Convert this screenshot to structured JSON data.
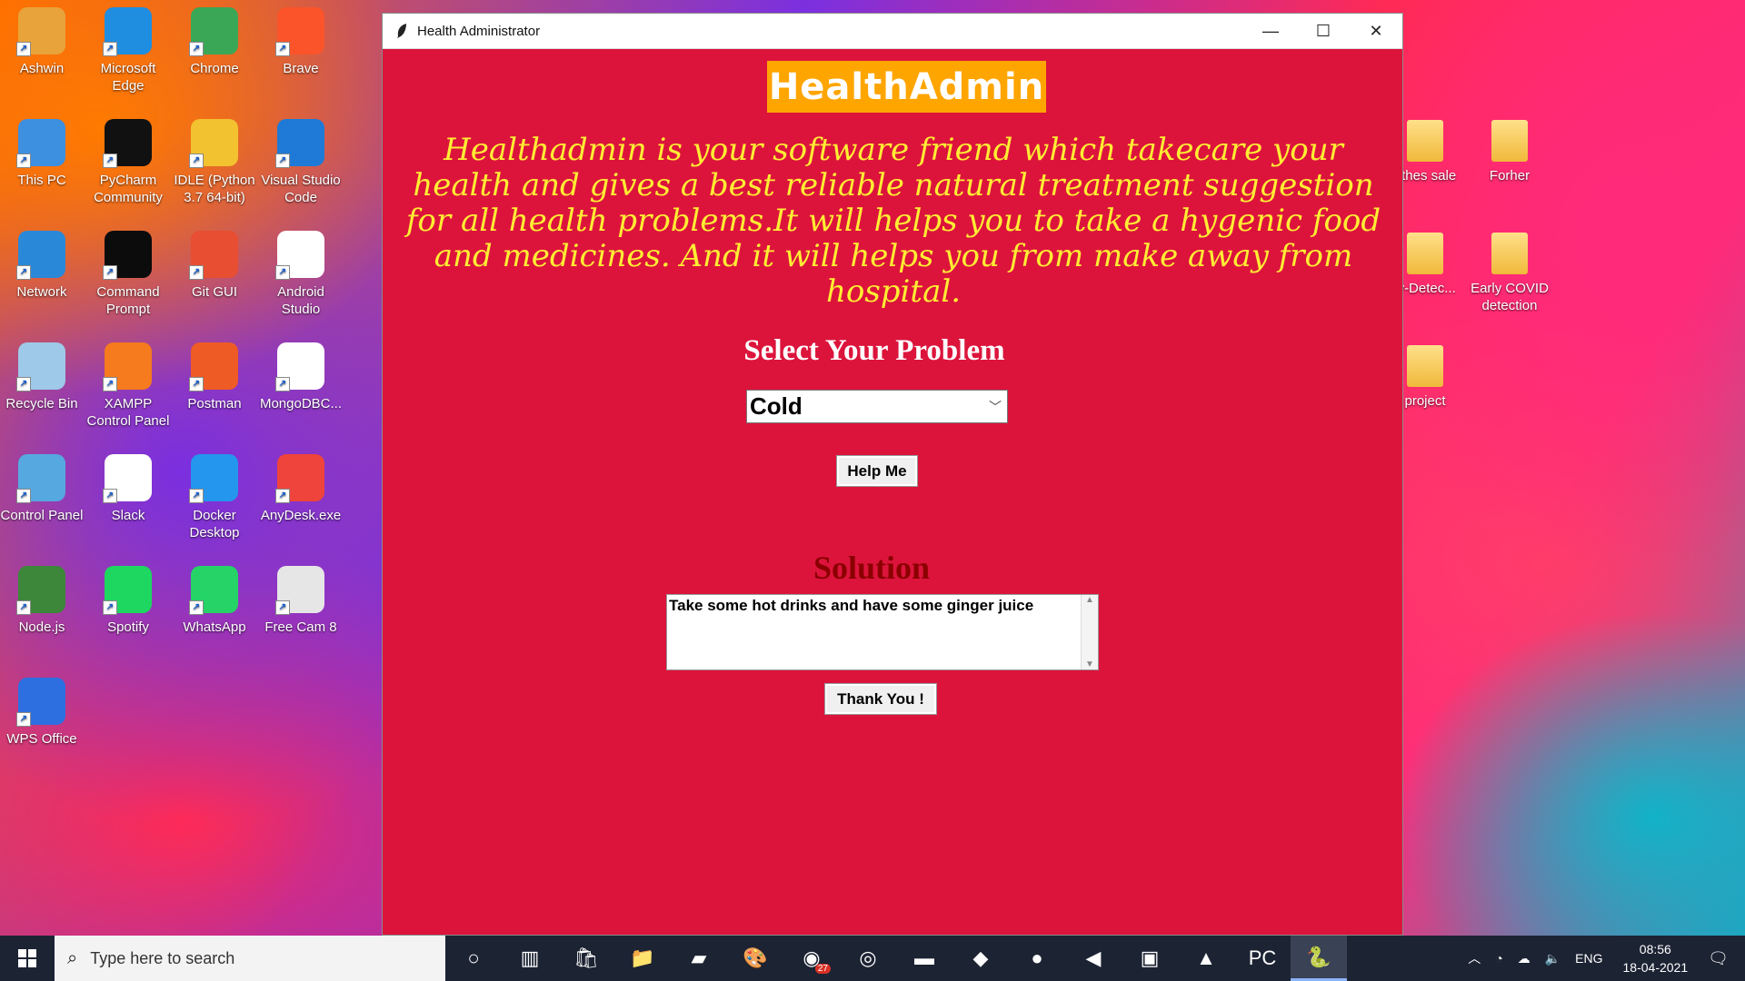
{
  "desktop": {
    "left_icons": [
      {
        "label": "Ashwin",
        "icon": "user-folder-icon",
        "color": "#e8a33a"
      },
      {
        "label": "Microsoft Edge",
        "icon": "edge-icon",
        "color": "#1f8de0"
      },
      {
        "label": "Chrome",
        "icon": "chrome-icon",
        "color": "#3aa757"
      },
      {
        "label": "Brave",
        "icon": "brave-icon",
        "color": "#fb542b"
      },
      {
        "label": "This PC",
        "icon": "computer-icon",
        "color": "#3d8fe0"
      },
      {
        "label": "PyCharm Community",
        "icon": "pycharm-icon",
        "color": "#111111"
      },
      {
        "label": "IDLE (Python 3.7 64-bit)",
        "icon": "python-icon",
        "color": "#f2c230"
      },
      {
        "label": "Visual Studio Code",
        "icon": "vscode-icon",
        "color": "#1e7ad6"
      },
      {
        "label": "Network",
        "icon": "network-icon",
        "color": "#2a88d8"
      },
      {
        "label": "Command Prompt",
        "icon": "terminal-icon",
        "color": "#0c0c0c"
      },
      {
        "label": "Git GUI",
        "icon": "git-icon",
        "color": "#e84e31"
      },
      {
        "label": "Android Studio",
        "icon": "android-studio-icon",
        "color": "#ffffff"
      },
      {
        "label": "Recycle Bin",
        "icon": "recycle-bin-icon",
        "color": "#9ec9e8"
      },
      {
        "label": "XAMPP Control Panel",
        "icon": "xampp-icon",
        "color": "#f67a1e"
      },
      {
        "label": "Postman",
        "icon": "postman-icon",
        "color": "#ef5b25"
      },
      {
        "label": "MongoDBC...",
        "icon": "mongodb-icon",
        "color": "#ffffff"
      },
      {
        "label": "Control Panel",
        "icon": "control-panel-icon",
        "color": "#56a8e0"
      },
      {
        "label": "Slack",
        "icon": "slack-icon",
        "color": "#ffffff"
      },
      {
        "label": "Docker Desktop",
        "icon": "docker-icon",
        "color": "#2496ed"
      },
      {
        "label": "AnyDesk.exe",
        "icon": "anydesk-icon",
        "color": "#ef443b"
      },
      {
        "label": "Node.js",
        "icon": "nodejs-icon",
        "color": "#3c873a"
      },
      {
        "label": "Spotify",
        "icon": "spotify-icon",
        "color": "#1ed760"
      },
      {
        "label": "WhatsApp",
        "icon": "whatsapp-icon",
        "color": "#25d366"
      },
      {
        "label": "Free Cam 8",
        "icon": "freecam-icon",
        "color": "#e6e6e6"
      },
      {
        "label": "WPS Office",
        "icon": "wps-icon",
        "color": "#2d6fe0"
      }
    ],
    "right_icons": [
      {
        "label": "othes sale",
        "icon": "folder-icon"
      },
      {
        "label": "Forher",
        "icon": "folder-icon"
      },
      {
        "label": "ly-Detec...",
        "icon": "folder-icon"
      },
      {
        "label": "Early COVID detection",
        "icon": "folder-icon"
      },
      {
        "label": "project",
        "icon": "folder-icon"
      }
    ]
  },
  "window": {
    "title": "Health Administrator",
    "minimize": "—",
    "maximize": "☐",
    "close": "✕"
  },
  "app": {
    "title": "HealthAdmin",
    "description": "Healthadmin is your software friend which takecare your health and gives a best reliable natural treatment suggestion for all health problems.It will helps you to take a hygenic food and medicines. And it will helps you from make away from hospital.",
    "select_heading": "Select Your Problem",
    "selected_problem": "Cold",
    "help_button": "Help Me",
    "solution_heading": "Solution",
    "solution_text": "Take some hot drinks and have some ginger juice",
    "thanks_button": "Thank You !",
    "colors": {
      "background": "#dc143c",
      "title_bg": "#ffa500",
      "desc": "#ffee33",
      "solution_heading": "#8b0000"
    }
  },
  "taskbar": {
    "search_placeholder": "Type here to search",
    "items": [
      {
        "icon": "cortana-icon",
        "glyph": "○"
      },
      {
        "icon": "task-view-icon",
        "glyph": "▥"
      },
      {
        "icon": "store-icon",
        "glyph": "🛍"
      },
      {
        "icon": "file-explorer-icon",
        "glyph": "📁"
      },
      {
        "icon": "notes-icon",
        "glyph": "▰"
      },
      {
        "icon": "paint-icon",
        "glyph": "🎨"
      },
      {
        "icon": "whatsapp-icon",
        "glyph": "◉"
      },
      {
        "icon": "chrome-icon",
        "glyph": "◎"
      },
      {
        "icon": "terminal-icon",
        "glyph": "▬"
      },
      {
        "icon": "git-icon",
        "glyph": "◆"
      },
      {
        "icon": "postman-icon",
        "glyph": "●"
      },
      {
        "icon": "vscode-icon",
        "glyph": "◀"
      },
      {
        "icon": "remote-desktop-icon",
        "glyph": "▣"
      },
      {
        "icon": "photos-icon",
        "glyph": "▲"
      },
      {
        "icon": "pycharm-icon",
        "glyph": "PC"
      },
      {
        "icon": "python-icon",
        "glyph": "🐍"
      }
    ],
    "whatsapp_badge": "27",
    "language": "ENG",
    "time": "08:56",
    "date": "18-04-2021"
  }
}
